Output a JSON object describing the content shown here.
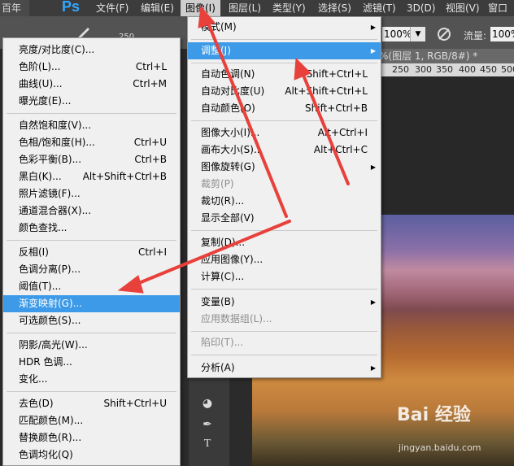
{
  "menubar": {
    "left_tab": "百年",
    "app_logo": "Ps",
    "items": [
      "文件(F)",
      "编辑(E)",
      "图像(I)",
      "图层(L)",
      "类型(Y)",
      "选择(S)",
      "滤镜(T)",
      "3D(D)",
      "视图(V)",
      "窗口"
    ]
  },
  "options": {
    "brush_size": "250",
    "zoom": "100%",
    "flow_label": "流量:",
    "flow": "100%"
  },
  "document": {
    "tab_title": "%(图层 1, RGB/8#) *",
    "ruler": [
      "250",
      "300",
      "350",
      "400",
      "450",
      "500"
    ]
  },
  "image_menu": {
    "items": [
      {
        "label": "模式(M)",
        "shortcut": "",
        "submenu": true
      },
      {
        "label": "调整(J)",
        "shortcut": "",
        "submenu": true,
        "highlighted": true
      },
      {
        "label": "自动色调(N)",
        "shortcut": "Shift+Ctrl+L"
      },
      {
        "label": "自动对比度(U)",
        "shortcut": "Alt+Shift+Ctrl+L"
      },
      {
        "label": "自动颜色(O)",
        "shortcut": "Shift+Ctrl+B"
      },
      {
        "label": "图像大小(I)...",
        "shortcut": "Alt+Ctrl+I"
      },
      {
        "label": "画布大小(S)...",
        "shortcut": "Alt+Ctrl+C"
      },
      {
        "label": "图像旋转(G)",
        "shortcut": "",
        "submenu": true
      },
      {
        "label": "裁剪(P)",
        "shortcut": "",
        "disabled": true
      },
      {
        "label": "裁切(R)...",
        "shortcut": ""
      },
      {
        "label": "显示全部(V)",
        "shortcut": ""
      },
      {
        "label": "复制(D)...",
        "shortcut": ""
      },
      {
        "label": "应用图像(Y)...",
        "shortcut": ""
      },
      {
        "label": "计算(C)...",
        "shortcut": ""
      },
      {
        "label": "变量(B)",
        "shortcut": "",
        "submenu": true
      },
      {
        "label": "应用数据组(L)...",
        "shortcut": "",
        "disabled": true
      },
      {
        "label": "陷印(T)...",
        "shortcut": "",
        "disabled": true
      },
      {
        "label": "分析(A)",
        "shortcut": "",
        "submenu": true
      }
    ]
  },
  "adjust_menu": {
    "items": [
      {
        "label": "亮度/对比度(C)...",
        "shortcut": ""
      },
      {
        "label": "色阶(L)...",
        "shortcut": "Ctrl+L"
      },
      {
        "label": "曲线(U)...",
        "shortcut": "Ctrl+M"
      },
      {
        "label": "曝光度(E)...",
        "shortcut": ""
      },
      {
        "label": "自然饱和度(V)...",
        "shortcut": ""
      },
      {
        "label": "色相/饱和度(H)...",
        "shortcut": "Ctrl+U"
      },
      {
        "label": "色彩平衡(B)...",
        "shortcut": "Ctrl+B"
      },
      {
        "label": "黑白(K)...",
        "shortcut": "Alt+Shift+Ctrl+B"
      },
      {
        "label": "照片滤镜(F)...",
        "shortcut": ""
      },
      {
        "label": "通道混合器(X)...",
        "shortcut": ""
      },
      {
        "label": "颜色查找...",
        "shortcut": ""
      },
      {
        "label": "反相(I)",
        "shortcut": "Ctrl+I"
      },
      {
        "label": "色调分离(P)...",
        "shortcut": ""
      },
      {
        "label": "阈值(T)...",
        "shortcut": ""
      },
      {
        "label": "渐变映射(G)...",
        "shortcut": "",
        "highlighted": true
      },
      {
        "label": "可选颜色(S)...",
        "shortcut": ""
      },
      {
        "label": "阴影/高光(W)...",
        "shortcut": ""
      },
      {
        "label": "HDR 色调...",
        "shortcut": ""
      },
      {
        "label": "变化...",
        "shortcut": ""
      },
      {
        "label": "去色(D)",
        "shortcut": "Shift+Ctrl+U"
      },
      {
        "label": "匹配颜色(M)...",
        "shortcut": ""
      },
      {
        "label": "替换颜色(R)...",
        "shortcut": ""
      },
      {
        "label": "色调均化(Q)",
        "shortcut": ""
      }
    ]
  },
  "watermark": {
    "text": "Bai 经验",
    "url": "jingyan.baidu.com"
  },
  "colors": {
    "highlight": "#3d9ae8",
    "annotation_arrow": "#e8413c",
    "menubar": "#3c3c3c"
  }
}
